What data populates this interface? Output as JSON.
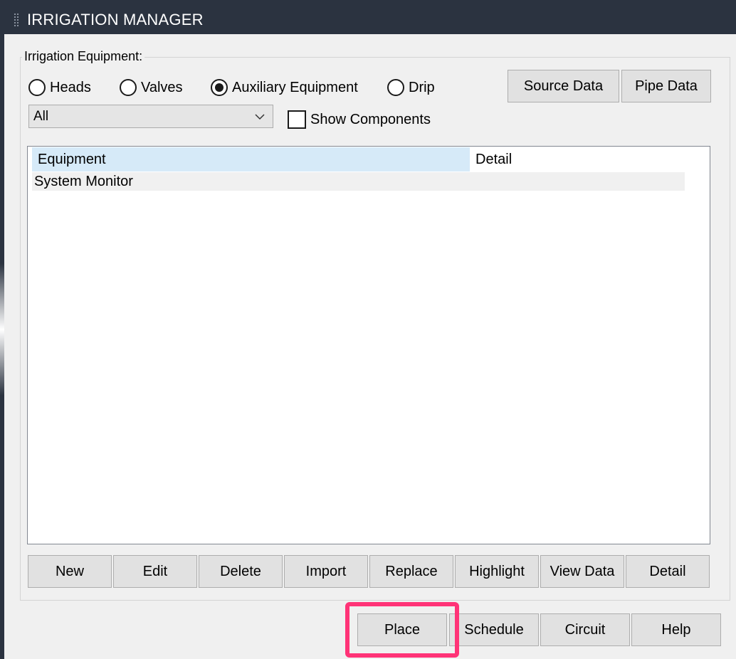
{
  "window": {
    "title": "IRRIGATION MANAGER"
  },
  "equipment": {
    "group_label": "Irrigation Equipment:",
    "radios": [
      {
        "label": "Heads",
        "checked": false
      },
      {
        "label": "Valves",
        "checked": false
      },
      {
        "label": "Auxiliary Equipment",
        "checked": true
      },
      {
        "label": "Drip",
        "checked": false
      }
    ],
    "source_data_label": "Source Data",
    "pipe_data_label": "Pipe Data",
    "filter_value": "All",
    "show_components_label": "Show Components",
    "show_components_checked": false
  },
  "list": {
    "columns": [
      "Equipment",
      "Detail"
    ],
    "rows": [
      {
        "equipment": "System Monitor",
        "detail": ""
      }
    ]
  },
  "actions": [
    "New",
    "Edit",
    "Delete",
    "Import",
    "Replace",
    "Highlight",
    "View Data",
    "Detail"
  ],
  "bottom_buttons": [
    "Place",
    "Schedule",
    "Circuit",
    "Help"
  ],
  "colors": {
    "titlebar": "#2b3340",
    "header_highlight": "#d6eaf8",
    "callout": "#ff3377"
  }
}
